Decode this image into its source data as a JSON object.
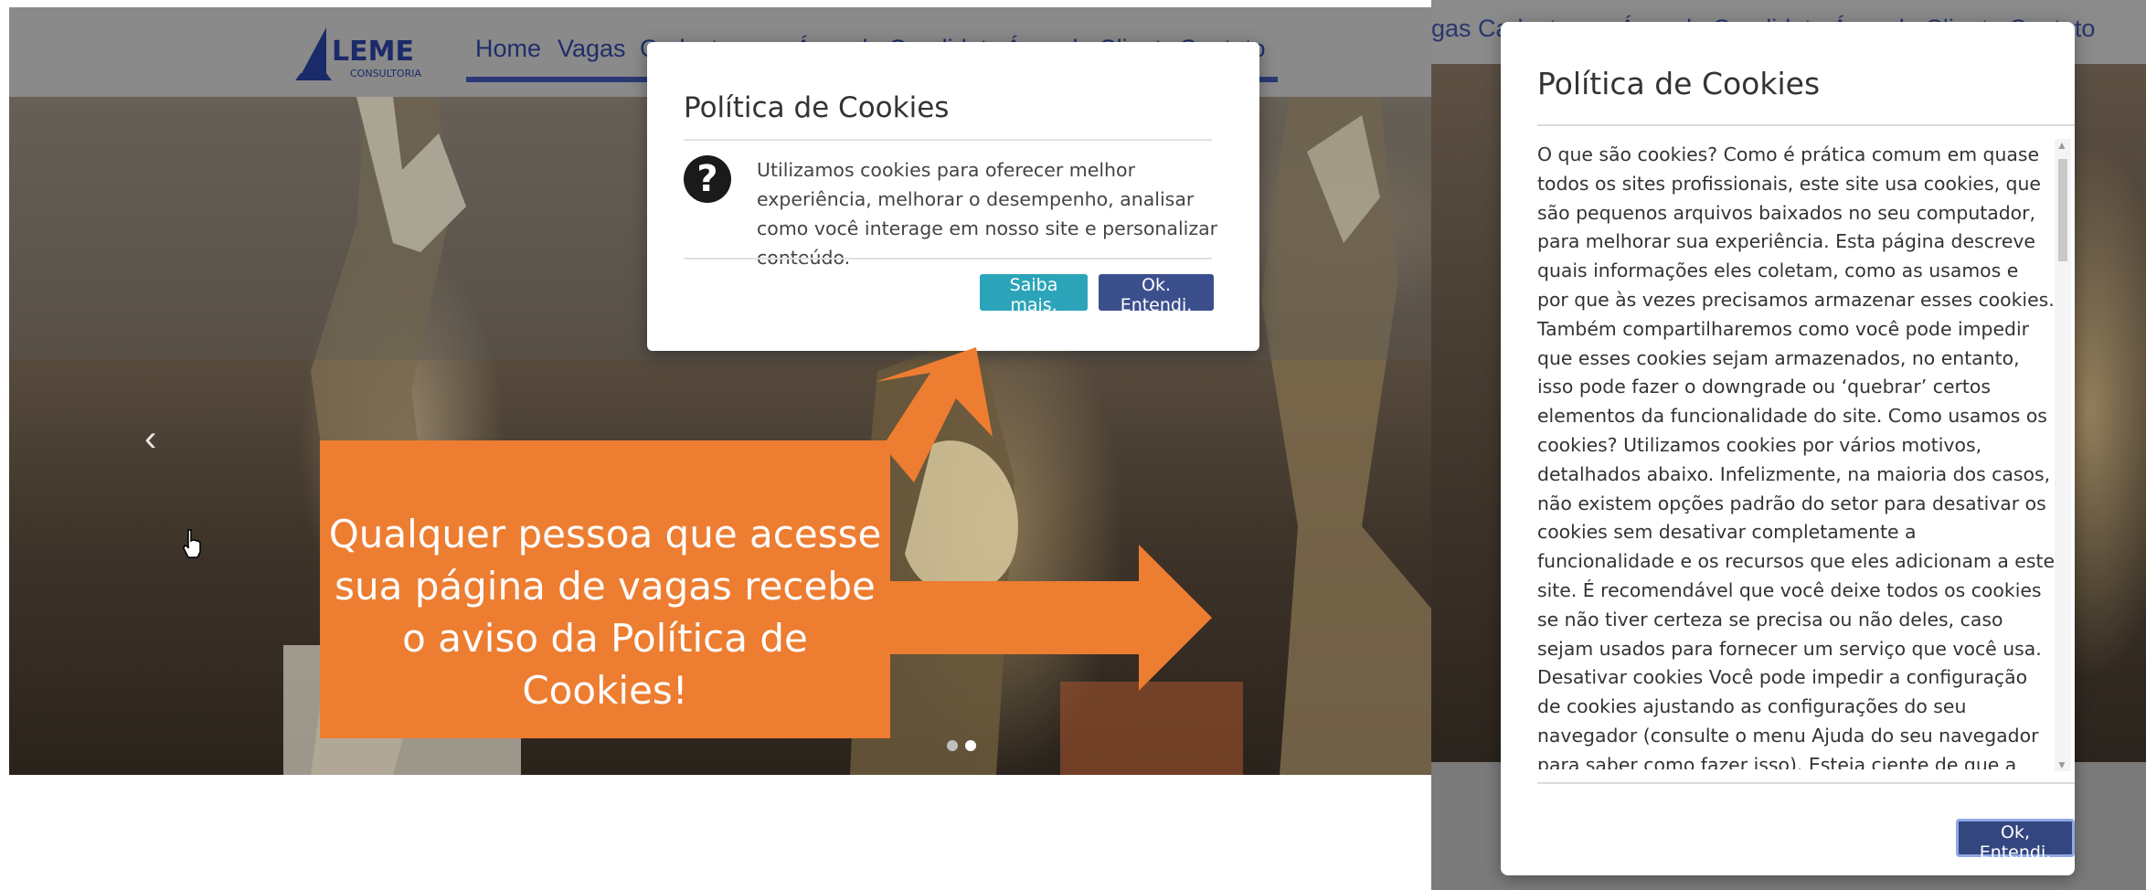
{
  "left_page": {
    "logo_text": "LEME",
    "logo_subtext": "CONSULTORIA",
    "nav": [
      "Home",
      "Vagas",
      "Cadastre-se",
      "Área do Candidato",
      "Área do Cliente",
      "Contato"
    ],
    "carousel_prev_icon": "chevron-left-icon",
    "carousel_dots": 2,
    "carousel_active_dot": 2
  },
  "cookie_modal_small": {
    "title": "Política de Cookies",
    "icon": "question-circle-icon",
    "text": "Utilizamos cookies para oferecer melhor experiência, melhorar o desempenho, analisar como você interage em nosso site e personalizar conteúdo.",
    "learn_more_label": "Saiba mais.",
    "ok_label": "Ok. Entendi."
  },
  "callout": {
    "text": "Qualquer pessoa que acesse sua página de vagas recebe o aviso da Política de Cookies!",
    "color": "#ed7d31"
  },
  "right_page": {
    "nav_fragment": "gas  Cadastre-se   Área do Candidato   Área do Cliente   Contato"
  },
  "cookie_modal_large": {
    "title": "Política de Cookies",
    "body": "O que são cookies? Como é prática comum em quase todos os sites profissionais, este site usa cookies, que são pequenos arquivos baixados no seu computador, para melhorar sua experiência. Esta página descreve quais informações eles coletam, como as usamos e por que às vezes precisamos armazenar esses cookies. Também compartilharemos como você pode impedir que esses cookies sejam armazenados, no entanto, isso pode fazer o downgrade ou ‘quebrar’ certos elementos da funcionalidade do site. Como usamos os cookies? Utilizamos cookies por vários motivos, detalhados abaixo. Infelizmente, na maioria dos casos, não existem opções padrão do setor para desativar os cookies sem desativar completamente a funcionalidade e os recursos que eles adicionam a este site. É recomendável que você deixe todos os cookies se não tiver certeza se precisa ou não deles, caso sejam usados para fornecer um serviço que você usa. Desativar cookies Você pode impedir a configuração de cookies ajustando as configurações do seu navegador (consulte o menu Ajuda do seu navegador para saber como fazer isso). Esteja ciente de que a desativação de cookies afetará a funcionalidade deste e",
    "ok_label": "Ok, Entendi."
  },
  "colors": {
    "brand_navy": "#2b3a75",
    "info_button": "#2ba4b9",
    "primary_button": "#3c4f8d",
    "callout_orange": "#ed7d31"
  }
}
